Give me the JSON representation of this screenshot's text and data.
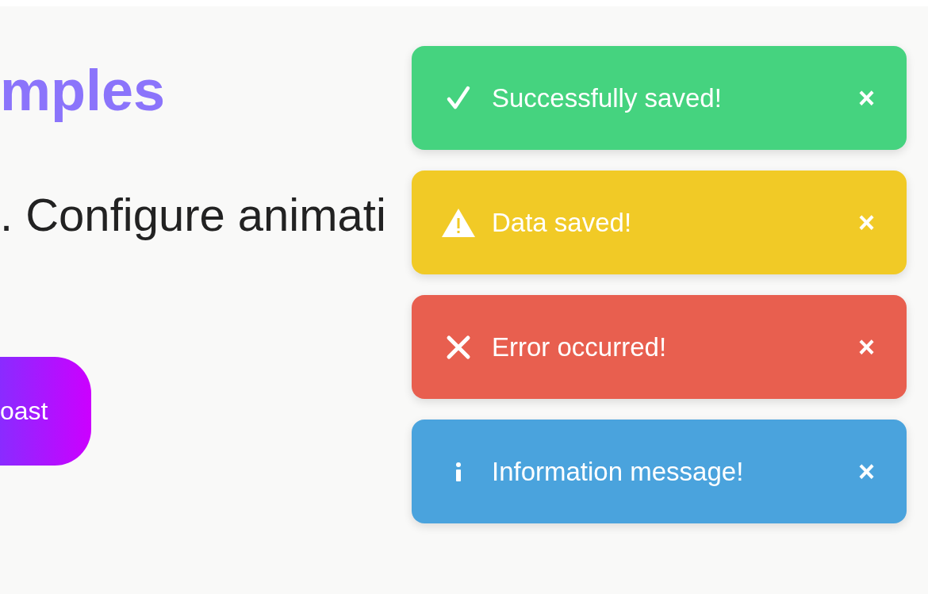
{
  "page": {
    "heading": "mples",
    "description": ". Configure animati",
    "button": "oast"
  },
  "toasts": [
    {
      "kind": "success",
      "message": "Successfully saved!",
      "close": "×"
    },
    {
      "kind": "warning",
      "message": "Data saved!",
      "close": "×"
    },
    {
      "kind": "error",
      "message": "Error occurred!",
      "close": "×"
    },
    {
      "kind": "info",
      "message": "Information message!",
      "close": "×"
    }
  ]
}
